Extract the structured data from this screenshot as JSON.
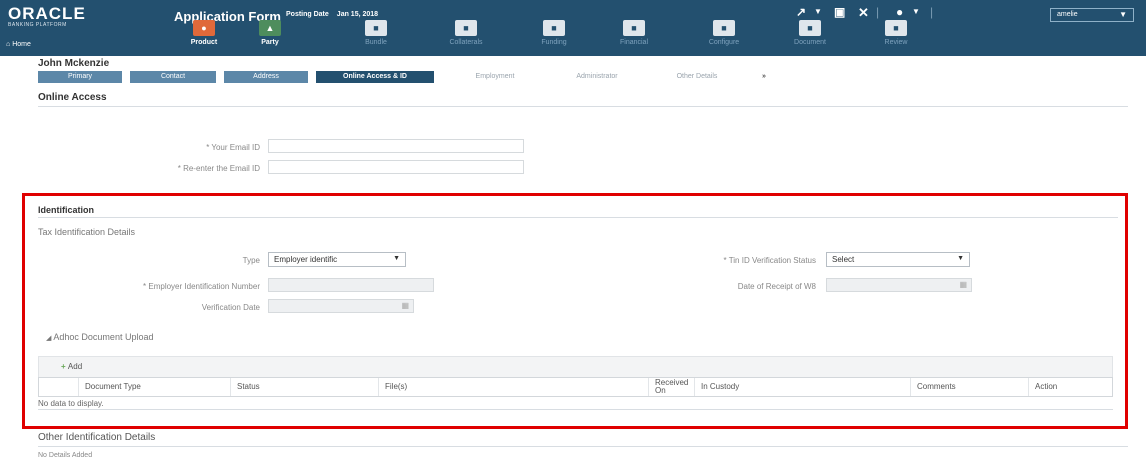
{
  "header": {
    "brand": "ORACLE",
    "brand_sub": "BANKING PLATFORM",
    "app_title": "Application Form",
    "posting_label": "Posting Date",
    "posting_date": "Jan 15, 2018",
    "user": "amelie",
    "home": "Home"
  },
  "train": [
    {
      "label": "Product",
      "icon": "product-icon",
      "color": "orange",
      "active": true
    },
    {
      "label": "Party",
      "icon": "party-icon",
      "color": "green",
      "active": true
    },
    {
      "label": "Bundle",
      "icon": "bundle-icon",
      "color": "grey",
      "active": false
    },
    {
      "label": "Collaterals",
      "icon": "collaterals-icon",
      "color": "grey",
      "active": false
    },
    {
      "label": "Funding",
      "icon": "funding-icon",
      "color": "grey",
      "active": false
    },
    {
      "label": "Financial",
      "icon": "financial-icon",
      "color": "grey",
      "active": false
    },
    {
      "label": "Configure",
      "icon": "configure-icon",
      "color": "grey",
      "active": false
    },
    {
      "label": "Document",
      "icon": "document-icon",
      "color": "grey",
      "active": false
    },
    {
      "label": "Review",
      "icon": "review-icon",
      "color": "grey",
      "active": false
    }
  ],
  "person_name": "John Mckenzie",
  "wizard": [
    "Primary",
    "Contact",
    "Address",
    "Online Access & ID",
    "Employment",
    "Administrator",
    "Other Details",
    "»"
  ],
  "online_access": {
    "title": "Online Access",
    "email_label": "* Your Email ID",
    "reemail_label": "* Re-enter the Email ID"
  },
  "identification": {
    "title": "Identification",
    "tax_title": "Tax Identification Details",
    "type_label": "Type",
    "type_value": "Employer identific",
    "tin_status_label": "* Tin ID Verification Status",
    "tin_status_value": "Select",
    "ein_label": "* Employer Identification Number",
    "receipt_label": "Date of Receipt of W8",
    "verification_label": "Verification Date",
    "adhoc_title": "Adhoc Document Upload",
    "add_label": "Add",
    "columns": [
      "Document Type",
      "Status",
      "File(s)",
      "Received On",
      "In Custody",
      "Comments",
      "Action"
    ],
    "no_data": "No data to display."
  },
  "other": {
    "title": "Other Identification Details",
    "no_details": "No Details Added"
  }
}
